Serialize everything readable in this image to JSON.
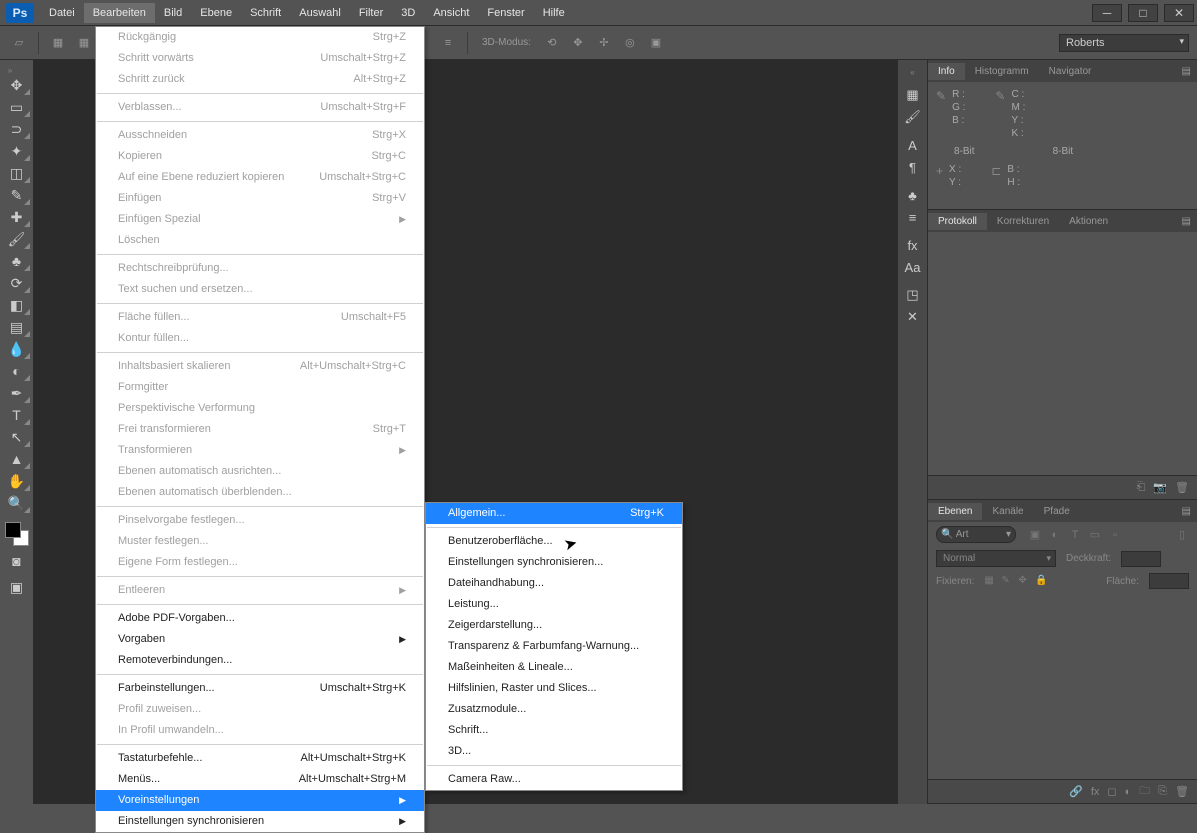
{
  "app": {
    "logo": "Ps"
  },
  "menubar": [
    "Datei",
    "Bearbeiten",
    "Bild",
    "Ebene",
    "Schrift",
    "Auswahl",
    "Filter",
    "3D",
    "Ansicht",
    "Fenster",
    "Hilfe"
  ],
  "active_menu_index": 1,
  "optionsbar": {
    "mode_label": "3D-Modus:",
    "workspace_selector": "Roberts"
  },
  "edit_menu": [
    {
      "label": "Rückgängig",
      "shortcut": "Strg+Z",
      "disabled": true
    },
    {
      "label": "Schritt vorwärts",
      "shortcut": "Umschalt+Strg+Z",
      "disabled": true
    },
    {
      "label": "Schritt zurück",
      "shortcut": "Alt+Strg+Z",
      "disabled": true
    },
    {
      "sep": true
    },
    {
      "label": "Verblassen...",
      "shortcut": "Umschalt+Strg+F",
      "disabled": true
    },
    {
      "sep": true
    },
    {
      "label": "Ausschneiden",
      "shortcut": "Strg+X",
      "disabled": true
    },
    {
      "label": "Kopieren",
      "shortcut": "Strg+C",
      "disabled": true
    },
    {
      "label": "Auf eine Ebene reduziert kopieren",
      "shortcut": "Umschalt+Strg+C",
      "disabled": true
    },
    {
      "label": "Einfügen",
      "shortcut": "Strg+V",
      "disabled": true
    },
    {
      "label": "Einfügen Spezial",
      "arrow": true,
      "disabled": true
    },
    {
      "label": "Löschen",
      "disabled": true
    },
    {
      "sep": true
    },
    {
      "label": "Rechtschreibprüfung...",
      "disabled": true
    },
    {
      "label": "Text suchen und ersetzen...",
      "disabled": true
    },
    {
      "sep": true
    },
    {
      "label": "Fläche füllen...",
      "shortcut": "Umschalt+F5",
      "disabled": true
    },
    {
      "label": "Kontur füllen...",
      "disabled": true
    },
    {
      "sep": true
    },
    {
      "label": "Inhaltsbasiert skalieren",
      "shortcut": "Alt+Umschalt+Strg+C",
      "disabled": true
    },
    {
      "label": "Formgitter",
      "disabled": true
    },
    {
      "label": "Perspektivische Verformung",
      "disabled": true
    },
    {
      "label": "Frei transformieren",
      "shortcut": "Strg+T",
      "disabled": true
    },
    {
      "label": "Transformieren",
      "arrow": true,
      "disabled": true
    },
    {
      "label": "Ebenen automatisch ausrichten...",
      "disabled": true
    },
    {
      "label": "Ebenen automatisch überblenden...",
      "disabled": true
    },
    {
      "sep": true
    },
    {
      "label": "Pinselvorgabe festlegen...",
      "disabled": true
    },
    {
      "label": "Muster festlegen...",
      "disabled": true
    },
    {
      "label": "Eigene Form festlegen...",
      "disabled": true
    },
    {
      "sep": true
    },
    {
      "label": "Entleeren",
      "arrow": true,
      "disabled": true
    },
    {
      "sep": true
    },
    {
      "label": "Adobe PDF-Vorgaben..."
    },
    {
      "label": "Vorgaben",
      "arrow": true
    },
    {
      "label": "Remoteverbindungen..."
    },
    {
      "sep": true
    },
    {
      "label": "Farbeinstellungen...",
      "shortcut": "Umschalt+Strg+K"
    },
    {
      "label": "Profil zuweisen...",
      "disabled": true
    },
    {
      "label": "In Profil umwandeln...",
      "disabled": true
    },
    {
      "sep": true
    },
    {
      "label": "Tastaturbefehle...",
      "shortcut": "Alt+Umschalt+Strg+K"
    },
    {
      "label": "Menüs...",
      "shortcut": "Alt+Umschalt+Strg+M"
    },
    {
      "label": "Voreinstellungen",
      "arrow": true,
      "highlighted": true
    },
    {
      "label": "Einstellungen synchronisieren",
      "arrow": true
    }
  ],
  "prefs_submenu": [
    {
      "label": "Allgemein...",
      "shortcut": "Strg+K",
      "highlighted": true
    },
    {
      "sep": true
    },
    {
      "label": "Benutzeroberfläche..."
    },
    {
      "label": "Einstellungen synchronisieren..."
    },
    {
      "label": "Dateihandhabung..."
    },
    {
      "label": "Leistung..."
    },
    {
      "label": "Zeigerdarstellung..."
    },
    {
      "label": "Transparenz & Farbumfang-Warnung..."
    },
    {
      "label": "Maßeinheiten & Lineale..."
    },
    {
      "label": "Hilfslinien, Raster und Slices..."
    },
    {
      "label": "Zusatzmodule..."
    },
    {
      "label": "Schrift..."
    },
    {
      "label": "3D..."
    },
    {
      "sep": true
    },
    {
      "label": "Camera Raw..."
    }
  ],
  "panels": {
    "info": {
      "tabs": [
        "Info",
        "Histogramm",
        "Navigator"
      ],
      "rgb": [
        "R :",
        "G :",
        "B :"
      ],
      "cmyk": [
        "C :",
        "M :",
        "Y :",
        "K :"
      ],
      "bit": "8-Bit",
      "bit2": "8-Bit",
      "xy": [
        "X :",
        "Y :"
      ],
      "bh": [
        "B :",
        "H :"
      ]
    },
    "protocol": {
      "tabs": [
        "Protokoll",
        "Korrekturen",
        "Aktionen"
      ]
    },
    "layers": {
      "tabs": [
        "Ebenen",
        "Kanäle",
        "Pfade"
      ],
      "search_placeholder": "Art",
      "blend_mode": "Normal",
      "opacity_label": "Deckkraft:",
      "lock_label": "Fixieren:",
      "fill_label": "Fläche:"
    }
  },
  "tools": [
    "move",
    "marquee",
    "lasso",
    "wand",
    "crop",
    "eyedropper",
    "heal",
    "brush",
    "stamp",
    "history",
    "eraser",
    "gradient",
    "blur",
    "dodge",
    "pen",
    "type",
    "path",
    "shape",
    "hand",
    "zoom"
  ],
  "dock_icons": [
    "swatches",
    "brush",
    "char",
    "para",
    "clone",
    "align",
    "styles",
    "glyphs",
    "3d",
    "measure"
  ]
}
